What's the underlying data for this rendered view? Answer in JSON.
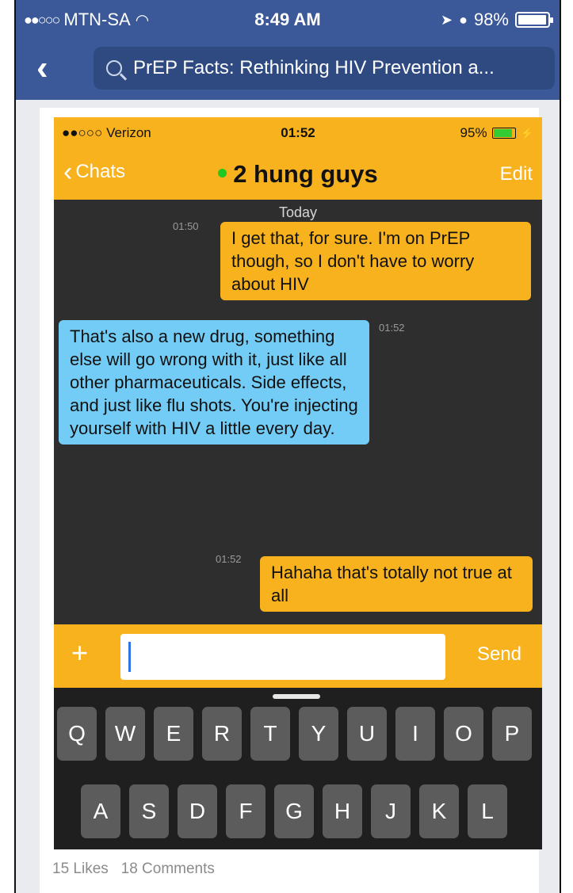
{
  "outer_status": {
    "carrier": "MTN-SA",
    "signal_dots": "●●○○○",
    "time": "8:49 AM",
    "battery": "98%",
    "battery_level": 0.98
  },
  "outer_nav": {
    "back_icon": "chevron-left-icon",
    "search_text": "PrEP Facts: Rethinking HIV Prevention a..."
  },
  "inner_status": {
    "carrier": "●●○○○ Verizon",
    "time": "01:52",
    "battery": "95%",
    "battery_level": 0.95
  },
  "chat": {
    "back_label": "Chats",
    "title": "2 hung guys",
    "edit_label": "Edit",
    "online_color": "#21c821",
    "day_separator": "Today",
    "messages": [
      {
        "side": "out",
        "time": "01:50",
        "text": "I get that, for sure. I'm on PrEP though, so I don't have to worry about HIV"
      },
      {
        "side": "in",
        "time": "01:52",
        "text": "That's also a new drug, something else will go wrong with it, just like all other pharmaceuticals. Side effects, and just like flu shots. You're injecting yourself with HIV a little every day."
      },
      {
        "side": "out",
        "time": "01:52",
        "text": "Hahaha that's totally not true at all"
      }
    ],
    "send_label": "Send",
    "plus_label": "+",
    "input_value": ""
  },
  "keyboard": {
    "row1": [
      "Q",
      "W",
      "E",
      "R",
      "T",
      "Y",
      "U",
      "I",
      "O",
      "P"
    ],
    "row2": [
      "A",
      "S",
      "D",
      "F",
      "G",
      "H",
      "J",
      "K",
      "L"
    ]
  },
  "footer": {
    "likes": "15 Likes",
    "comments": "18 Comments"
  },
  "colors": {
    "facebook_blue": "#3b5998",
    "grindr_yellow": "#f7b21d",
    "incoming_bubble": "#72ccf5"
  }
}
